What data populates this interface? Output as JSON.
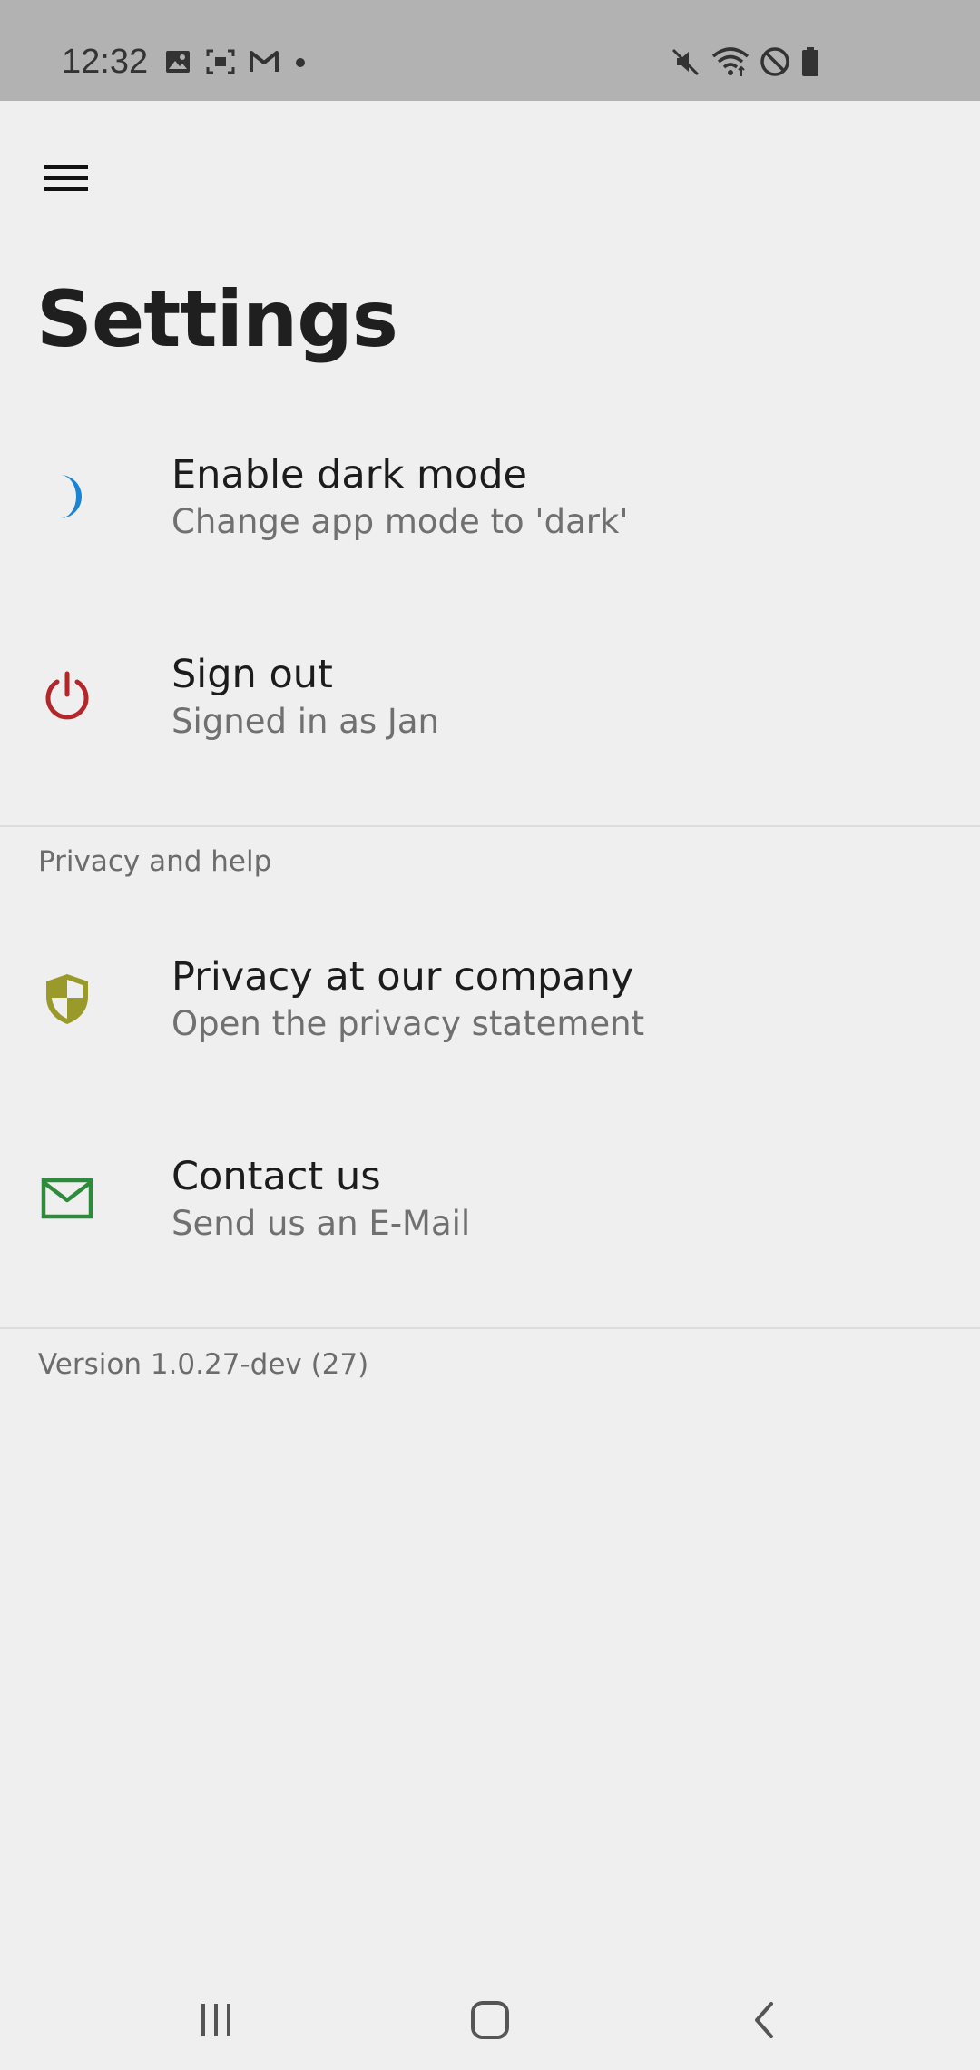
{
  "status_bar": {
    "time": "12:32",
    "left_icons": [
      "image-icon",
      "screen-record-icon",
      "gmail-icon",
      "dot-icon"
    ],
    "right_icons": [
      "mute-icon",
      "wifi-icon",
      "do-not-disturb-icon",
      "battery-icon"
    ]
  },
  "header": {
    "menu_icon": "hamburger-menu-icon",
    "title": "Settings"
  },
  "items": [
    {
      "icon": "moon-icon",
      "icon_color": "#1a83d4",
      "title": "Enable dark mode",
      "subtitle": "Change app mode to 'dark'"
    },
    {
      "icon": "power-icon",
      "icon_color": "#b3262a",
      "title": "Sign out",
      "subtitle": "Signed in as Jan"
    }
  ],
  "privacy_section": {
    "header": "Privacy and help",
    "items": [
      {
        "icon": "shield-icon",
        "icon_color": "#9a9a2a",
        "title": "Privacy at our company",
        "subtitle": "Open the privacy statement"
      },
      {
        "icon": "mail-icon",
        "icon_color": "#2e8b3c",
        "title": "Contact us",
        "subtitle": "Send us an E-Mail"
      }
    ]
  },
  "footer": {
    "version": "Version 1.0.27-dev (27)"
  },
  "nav_bar": {
    "buttons": [
      "recent-apps-icon",
      "home-icon",
      "back-icon"
    ]
  }
}
